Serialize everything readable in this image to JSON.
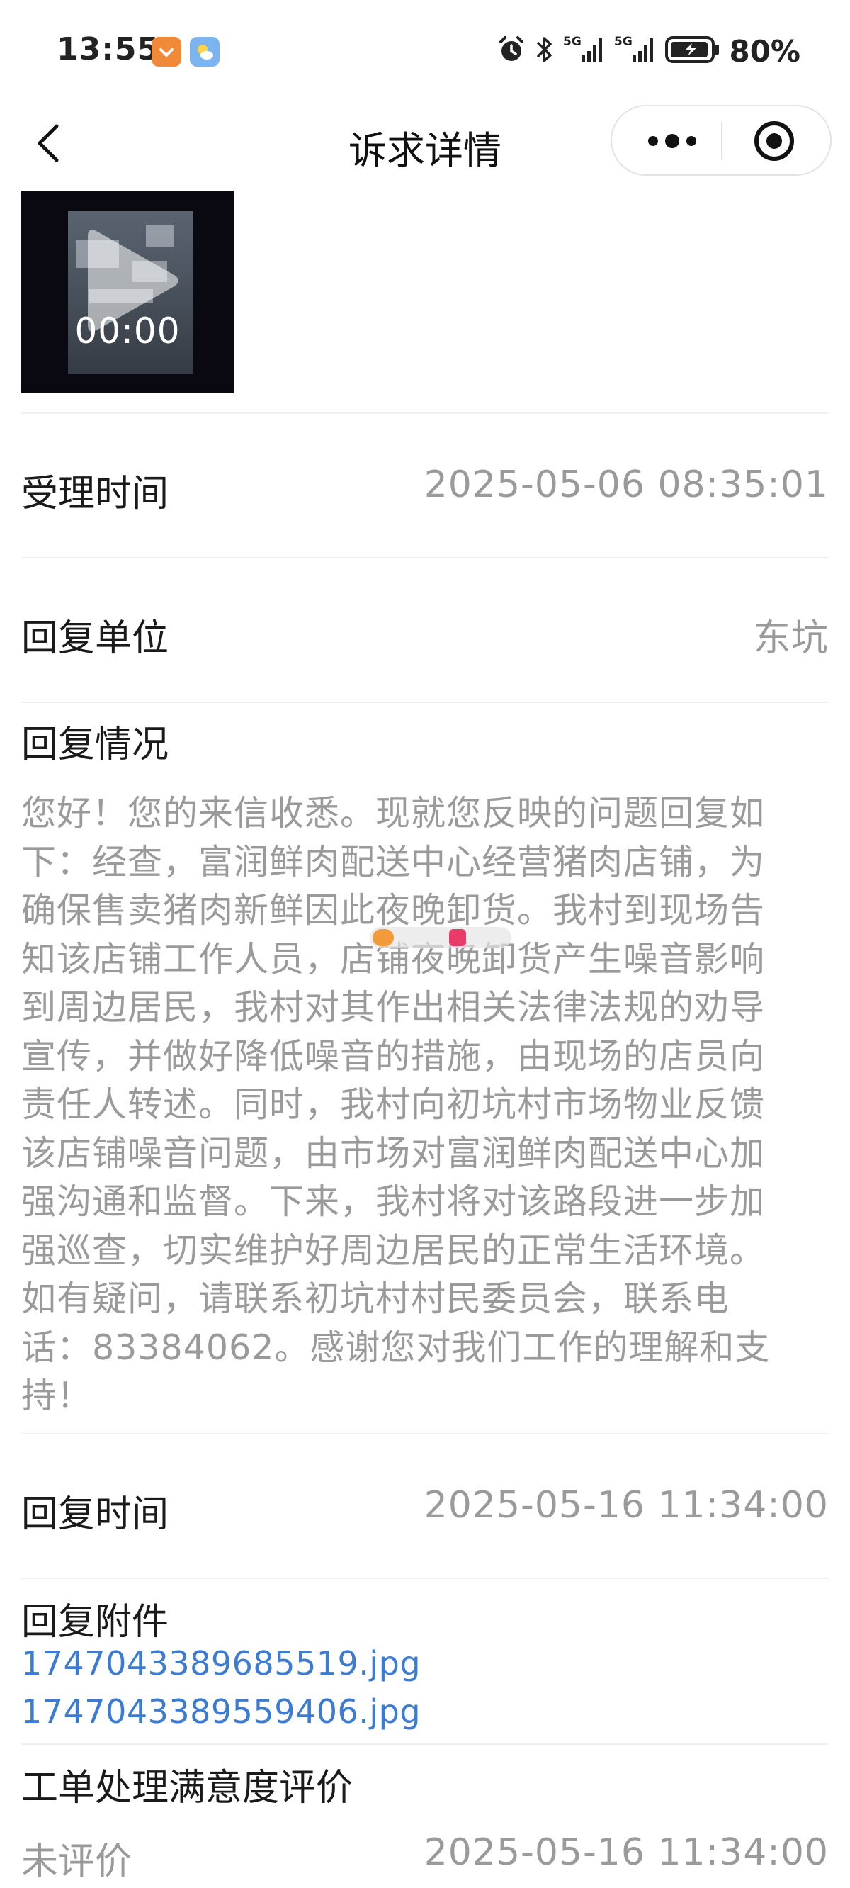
{
  "status_bar": {
    "time": "13:55",
    "battery": "80%",
    "icons": [
      "alarm-icon",
      "bluetooth-icon",
      "signal-5g-icon",
      "signal-5g-icon",
      "battery-charging-icon"
    ]
  },
  "header": {
    "title": "诉求详情",
    "back_icon": "chevron-left-icon",
    "more_icon": "more-dots-icon",
    "close_icon": "target-close-icon"
  },
  "video": {
    "duration": "00:00"
  },
  "accept_time": {
    "label": "受理时间",
    "value": "2025-05-06 08:35:01"
  },
  "reply_unit": {
    "label": "回复单位",
    "value": "东坑"
  },
  "reply_status": {
    "label": "回复情况",
    "lines": [
      "您好！您的来信收悉。现就您反映的问题回复如",
      "下：经查，富润鲜肉配送中心经营猪肉店铺，为",
      "确保售卖猪肉新鲜因此夜晚卸货。我村到现场告",
      "知该店铺工作人员，店铺夜晚卸货产生噪音影响",
      "到周边居民，我村对其作出相关法律法规的劝导",
      "宣传，并做好降低噪音的措施，由现场的店员向",
      "责任人转述。同时，我村向初坑村市场物业反馈",
      "该店铺噪音问题，由市场对富润鲜肉配送中心加",
      "强沟通和监督。下来，我村将对该路段进一步加",
      "强巡查，切实维护好周边居民的正常生活环境。",
      "如有疑问，请联系初坑村村民委员会，联系电",
      "话：83384062。感谢您对我们工作的理解和支",
      "持！"
    ]
  },
  "reply_time": {
    "label": "回复时间",
    "value": "2025-05-16 11:34:00"
  },
  "reply_attachments": {
    "label": "回复附件",
    "files": [
      "1747043389685519.jpg",
      "1747043389559406.jpg"
    ]
  },
  "satisfaction": {
    "label": "工单处理满意度评价",
    "status": "未评价",
    "time": "2025-05-16 11:34:00"
  },
  "colors": {
    "label_text": "#1a1a1a",
    "muted_text": "#9a9a9a",
    "link": "#3b7bd4",
    "divider": "#f0f0f0"
  }
}
